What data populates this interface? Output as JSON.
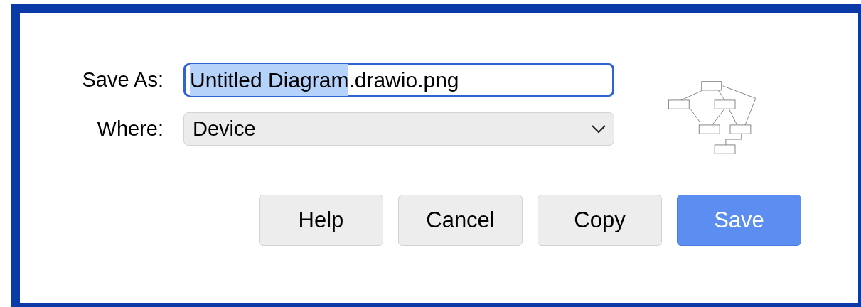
{
  "save_as": {
    "label": "Save As:",
    "value_selected": "Untitled Diagram",
    "value_rest": ".drawio.png",
    "focused": true
  },
  "where": {
    "label": "Where:",
    "value": "Device"
  },
  "buttons": [
    {
      "label": "Help",
      "default": false
    },
    {
      "label": "Cancel",
      "default": false
    },
    {
      "label": "Copy",
      "default": false
    },
    {
      "label": "Save",
      "default": true
    }
  ]
}
